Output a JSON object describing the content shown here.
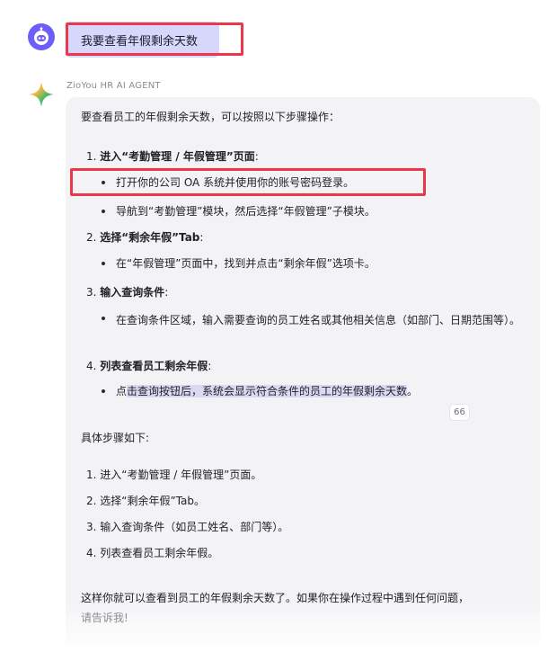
{
  "user": {
    "avatar_icon": "robot-face-icon",
    "message": "我要查看年假剩余天数"
  },
  "agent": {
    "icon": "sparkle-star-icon",
    "name": "ZioYou HR AI AGENT",
    "intro": "要查看员工的年假剩余天数，可以按照以下步骤操作：",
    "steps": [
      {
        "num": "1.",
        "title": "进入“考勤管理 / 年假管理”页面",
        "colon": ":",
        "bullets": [
          "打开你的公司 OA 系统并使用你的账号密码登录。",
          "导航到“考勤管理”模块，然后选择“年假管理”子模块。"
        ]
      },
      {
        "num": "2.",
        "title": "选择“剩余年假”Tab",
        "colon": ":",
        "bullets": [
          "在“年假管理”页面中，找到并点击“剩余年假”选项卡。"
        ]
      },
      {
        "num": "3.",
        "title": "输入查询条件",
        "colon": ":",
        "bullets": [
          "在查询条件区域，输入需要查询的员工姓名或其他相关信息（如部门、日期范围等）。"
        ]
      },
      {
        "num": "4.",
        "title": "列表查看员工剩余年假",
        "colon": ":",
        "bullets": [
          {
            "pre": "点",
            "selected": "击查询按钮后，系统会显示符合条件的员工的年假剩余天数",
            "post": "。"
          }
        ]
      }
    ],
    "citation": "66",
    "summary_title": "具体步骤如下:",
    "summary_steps": [
      "1. 进入“考勤管理 / 年假管理”页面。",
      "2. 选择“剩余年假”Tab。",
      "3. 输入查询条件（如员工姓名、部门等）。",
      "4. 列表查看员工剩余年假。"
    ],
    "closing_line1": "这样你就可以查看到员工的年假剩余天数了。如果你在操作过程中遇到任何问题，",
    "closing_line2": "请告诉我!"
  },
  "colors": {
    "avatar": "#6d5efc",
    "user_bubble": "#d7d6fb",
    "highlight_border": "#e8384a",
    "card_background": "#f3f3f6",
    "selection": "#d9d9f4"
  }
}
